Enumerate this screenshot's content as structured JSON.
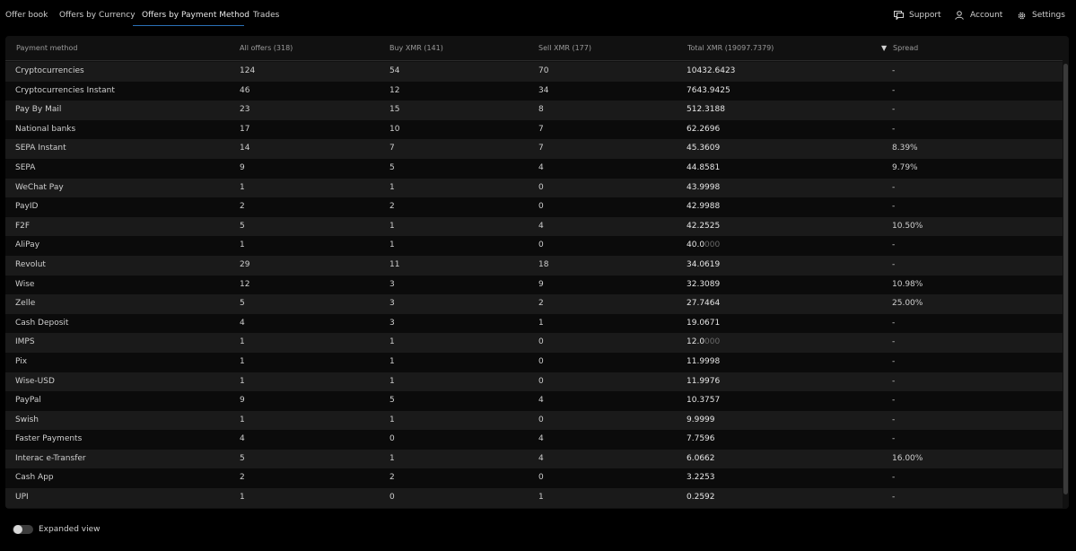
{
  "tabs": [
    {
      "label": "Offer book",
      "active": false
    },
    {
      "label": "Offers by Currency",
      "active": false
    },
    {
      "label": "Offers by Payment Method",
      "active": true
    },
    {
      "label": "Trades",
      "active": false
    }
  ],
  "top_right": {
    "support": {
      "label": "Support",
      "icon": "chat-bubble-icon"
    },
    "account": {
      "label": "Account",
      "icon": "user-icon"
    },
    "settings": {
      "label": "Settings",
      "icon": "gear-icon"
    }
  },
  "table": {
    "columns": [
      "Payment method",
      "All offers (318)",
      "Buy XMR (141)",
      "Sell XMR (177)",
      "Total XMR (19097.7379)",
      "Spread"
    ],
    "sort": {
      "column": "Spread",
      "indicator": "▼"
    },
    "rows": [
      {
        "method": "Cryptocurrencies",
        "all": "124",
        "buy": "54",
        "sell": "70",
        "total": "10432.6423",
        "total_dim": "",
        "spread": "-"
      },
      {
        "method": "Cryptocurrencies Instant",
        "all": "46",
        "buy": "12",
        "sell": "34",
        "total": "7643.9425",
        "total_dim": "",
        "spread": "-"
      },
      {
        "method": "Pay By Mail",
        "all": "23",
        "buy": "15",
        "sell": "8",
        "total": "512.3188",
        "total_dim": "",
        "spread": "-"
      },
      {
        "method": "National banks",
        "all": "17",
        "buy": "10",
        "sell": "7",
        "total": "62.2696",
        "total_dim": "",
        "spread": "-"
      },
      {
        "method": "SEPA Instant",
        "all": "14",
        "buy": "7",
        "sell": "7",
        "total": "45.3609",
        "total_dim": "",
        "spread": "8.39%"
      },
      {
        "method": "SEPA",
        "all": "9",
        "buy": "5",
        "sell": "4",
        "total": "44.8581",
        "total_dim": "",
        "spread": "9.79%"
      },
      {
        "method": "WeChat Pay",
        "all": "1",
        "buy": "1",
        "sell": "0",
        "total": "43.9998",
        "total_dim": "",
        "spread": "-"
      },
      {
        "method": "PayID",
        "all": "2",
        "buy": "2",
        "sell": "0",
        "total": "42.9988",
        "total_dim": "",
        "spread": "-"
      },
      {
        "method": "F2F",
        "all": "5",
        "buy": "1",
        "sell": "4",
        "total": "42.2525",
        "total_dim": "",
        "spread": "10.50%"
      },
      {
        "method": "AliPay",
        "all": "1",
        "buy": "1",
        "sell": "0",
        "total": "40.0",
        "total_dim": "000",
        "spread": "-"
      },
      {
        "method": "Revolut",
        "all": "29",
        "buy": "11",
        "sell": "18",
        "total": "34.0619",
        "total_dim": "",
        "spread": "-"
      },
      {
        "method": "Wise",
        "all": "12",
        "buy": "3",
        "sell": "9",
        "total": "32.3089",
        "total_dim": "",
        "spread": "10.98%"
      },
      {
        "method": "Zelle",
        "all": "5",
        "buy": "3",
        "sell": "2",
        "total": "27.7464",
        "total_dim": "",
        "spread": "25.00%"
      },
      {
        "method": "Cash Deposit",
        "all": "4",
        "buy": "3",
        "sell": "1",
        "total": "19.0671",
        "total_dim": "",
        "spread": "-"
      },
      {
        "method": "IMPS",
        "all": "1",
        "buy": "1",
        "sell": "0",
        "total": "12.0",
        "total_dim": "000",
        "spread": "-"
      },
      {
        "method": "Pix",
        "all": "1",
        "buy": "1",
        "sell": "0",
        "total": "11.9998",
        "total_dim": "",
        "spread": "-"
      },
      {
        "method": "Wise-USD",
        "all": "1",
        "buy": "1",
        "sell": "0",
        "total": "11.9976",
        "total_dim": "",
        "spread": "-"
      },
      {
        "method": "PayPal",
        "all": "9",
        "buy": "5",
        "sell": "4",
        "total": "10.3757",
        "total_dim": "",
        "spread": "-"
      },
      {
        "method": "Swish",
        "all": "1",
        "buy": "1",
        "sell": "0",
        "total": "9.9999",
        "total_dim": "",
        "spread": "-"
      },
      {
        "method": "Faster Payments",
        "all": "4",
        "buy": "0",
        "sell": "4",
        "total": "7.7596",
        "total_dim": "",
        "spread": "-"
      },
      {
        "method": "Interac e-Transfer",
        "all": "5",
        "buy": "1",
        "sell": "4",
        "total": "6.0662",
        "total_dim": "",
        "spread": "16.00%"
      },
      {
        "method": "Cash App",
        "all": "2",
        "buy": "2",
        "sell": "0",
        "total": "3.2253",
        "total_dim": "",
        "spread": "-"
      },
      {
        "method": "UPI",
        "all": "1",
        "buy": "0",
        "sell": "1",
        "total": "0.2592",
        "total_dim": "",
        "spread": "-"
      }
    ]
  },
  "footer": {
    "expanded_view_label": "Expanded view",
    "expanded_view_on": false
  }
}
